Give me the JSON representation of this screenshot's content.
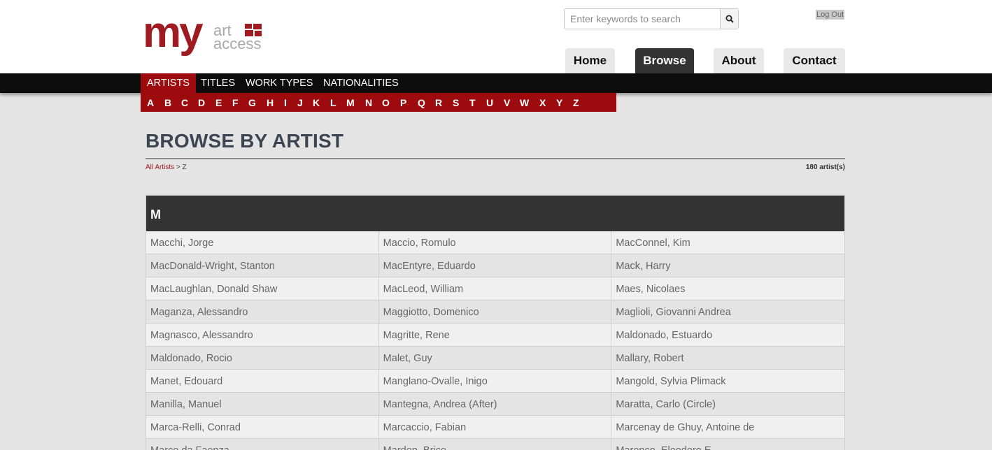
{
  "logo": {
    "my": "my",
    "art": "art",
    "access": "access"
  },
  "search": {
    "placeholder": "Enter keywords to search"
  },
  "logout_label": "Log Out",
  "nav": [
    {
      "label": "Home",
      "active": false
    },
    {
      "label": "Browse",
      "active": true
    },
    {
      "label": "About",
      "active": false
    },
    {
      "label": "Contact",
      "active": false
    }
  ],
  "categories": [
    "ARTISTS",
    "TITLES",
    "WORK TYPES",
    "NATIONALITIES"
  ],
  "active_category": "ARTISTS",
  "letters": [
    "A",
    "B",
    "C",
    "D",
    "E",
    "F",
    "G",
    "H",
    "I",
    "J",
    "K",
    "L",
    "M",
    "N",
    "O",
    "P",
    "Q",
    "R",
    "S",
    "T",
    "U",
    "V",
    "W",
    "X",
    "Y",
    "Z"
  ],
  "page_title": "BROWSE BY ARTIST",
  "breadcrumb": {
    "link": "All Artists",
    "separator": " > ",
    "current": "Z"
  },
  "artist_count": "180 artist(s)",
  "section_letter": "M",
  "rows": [
    [
      "Macchi, Jorge",
      "Maccio, Romulo",
      "MacConnel, Kim"
    ],
    [
      "MacDonald-Wright, Stanton",
      "MacEntyre, Eduardo",
      "Mack, Harry"
    ],
    [
      "MacLaughlan, Donald Shaw",
      "MacLeod, William",
      "Maes, Nicolaes"
    ],
    [
      "Maganza, Alessandro",
      "Maggiotto, Domenico",
      "Maglioli, Giovanni Andrea"
    ],
    [
      "Magnasco, Alessandro",
      "Magritte, Rene",
      "Maldonado, Estuardo"
    ],
    [
      "Maldonado, Rocio",
      "Malet, Guy",
      "Mallary, Robert"
    ],
    [
      "Manet, Edouard",
      "Manglano-Ovalle, Inigo",
      "Mangold, Sylvia Plimack"
    ],
    [
      "Manilla, Manuel",
      "Mantegna, Andrea (After)",
      "Maratta, Carlo (Circle)"
    ],
    [
      "Marca-Relli, Conrad",
      "Marcaccio, Fabian",
      "Marcenay de Ghuy, Antoine de"
    ],
    [
      "Marco da Faenza",
      "Marden, Brice",
      "Marenco, Eleodoro E."
    ]
  ]
}
